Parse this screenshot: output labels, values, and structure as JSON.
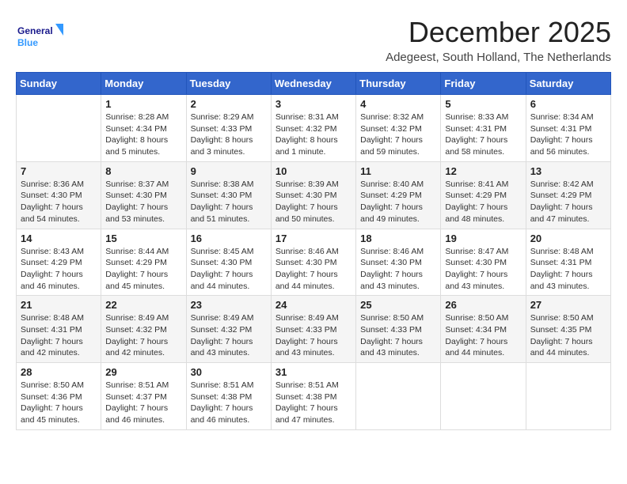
{
  "header": {
    "logo_general": "General",
    "logo_blue": "Blue",
    "month_title": "December 2025",
    "location": "Adegeest, South Holland, The Netherlands"
  },
  "weekdays": [
    "Sunday",
    "Monday",
    "Tuesday",
    "Wednesday",
    "Thursday",
    "Friday",
    "Saturday"
  ],
  "weeks": [
    [
      {
        "day": "",
        "info": ""
      },
      {
        "day": "1",
        "info": "Sunrise: 8:28 AM\nSunset: 4:34 PM\nDaylight: 8 hours\nand 5 minutes."
      },
      {
        "day": "2",
        "info": "Sunrise: 8:29 AM\nSunset: 4:33 PM\nDaylight: 8 hours\nand 3 minutes."
      },
      {
        "day": "3",
        "info": "Sunrise: 8:31 AM\nSunset: 4:32 PM\nDaylight: 8 hours\nand 1 minute."
      },
      {
        "day": "4",
        "info": "Sunrise: 8:32 AM\nSunset: 4:32 PM\nDaylight: 7 hours\nand 59 minutes."
      },
      {
        "day": "5",
        "info": "Sunrise: 8:33 AM\nSunset: 4:31 PM\nDaylight: 7 hours\nand 58 minutes."
      },
      {
        "day": "6",
        "info": "Sunrise: 8:34 AM\nSunset: 4:31 PM\nDaylight: 7 hours\nand 56 minutes."
      }
    ],
    [
      {
        "day": "7",
        "info": "Sunrise: 8:36 AM\nSunset: 4:30 PM\nDaylight: 7 hours\nand 54 minutes."
      },
      {
        "day": "8",
        "info": "Sunrise: 8:37 AM\nSunset: 4:30 PM\nDaylight: 7 hours\nand 53 minutes."
      },
      {
        "day": "9",
        "info": "Sunrise: 8:38 AM\nSunset: 4:30 PM\nDaylight: 7 hours\nand 51 minutes."
      },
      {
        "day": "10",
        "info": "Sunrise: 8:39 AM\nSunset: 4:30 PM\nDaylight: 7 hours\nand 50 minutes."
      },
      {
        "day": "11",
        "info": "Sunrise: 8:40 AM\nSunset: 4:29 PM\nDaylight: 7 hours\nand 49 minutes."
      },
      {
        "day": "12",
        "info": "Sunrise: 8:41 AM\nSunset: 4:29 PM\nDaylight: 7 hours\nand 48 minutes."
      },
      {
        "day": "13",
        "info": "Sunrise: 8:42 AM\nSunset: 4:29 PM\nDaylight: 7 hours\nand 47 minutes."
      }
    ],
    [
      {
        "day": "14",
        "info": "Sunrise: 8:43 AM\nSunset: 4:29 PM\nDaylight: 7 hours\nand 46 minutes."
      },
      {
        "day": "15",
        "info": "Sunrise: 8:44 AM\nSunset: 4:29 PM\nDaylight: 7 hours\nand 45 minutes."
      },
      {
        "day": "16",
        "info": "Sunrise: 8:45 AM\nSunset: 4:30 PM\nDaylight: 7 hours\nand 44 minutes."
      },
      {
        "day": "17",
        "info": "Sunrise: 8:46 AM\nSunset: 4:30 PM\nDaylight: 7 hours\nand 44 minutes."
      },
      {
        "day": "18",
        "info": "Sunrise: 8:46 AM\nSunset: 4:30 PM\nDaylight: 7 hours\nand 43 minutes."
      },
      {
        "day": "19",
        "info": "Sunrise: 8:47 AM\nSunset: 4:30 PM\nDaylight: 7 hours\nand 43 minutes."
      },
      {
        "day": "20",
        "info": "Sunrise: 8:48 AM\nSunset: 4:31 PM\nDaylight: 7 hours\nand 43 minutes."
      }
    ],
    [
      {
        "day": "21",
        "info": "Sunrise: 8:48 AM\nSunset: 4:31 PM\nDaylight: 7 hours\nand 42 minutes."
      },
      {
        "day": "22",
        "info": "Sunrise: 8:49 AM\nSunset: 4:32 PM\nDaylight: 7 hours\nand 42 minutes."
      },
      {
        "day": "23",
        "info": "Sunrise: 8:49 AM\nSunset: 4:32 PM\nDaylight: 7 hours\nand 43 minutes."
      },
      {
        "day": "24",
        "info": "Sunrise: 8:49 AM\nSunset: 4:33 PM\nDaylight: 7 hours\nand 43 minutes."
      },
      {
        "day": "25",
        "info": "Sunrise: 8:50 AM\nSunset: 4:33 PM\nDaylight: 7 hours\nand 43 minutes."
      },
      {
        "day": "26",
        "info": "Sunrise: 8:50 AM\nSunset: 4:34 PM\nDaylight: 7 hours\nand 44 minutes."
      },
      {
        "day": "27",
        "info": "Sunrise: 8:50 AM\nSunset: 4:35 PM\nDaylight: 7 hours\nand 44 minutes."
      }
    ],
    [
      {
        "day": "28",
        "info": "Sunrise: 8:50 AM\nSunset: 4:36 PM\nDaylight: 7 hours\nand 45 minutes."
      },
      {
        "day": "29",
        "info": "Sunrise: 8:51 AM\nSunset: 4:37 PM\nDaylight: 7 hours\nand 46 minutes."
      },
      {
        "day": "30",
        "info": "Sunrise: 8:51 AM\nSunset: 4:38 PM\nDaylight: 7 hours\nand 46 minutes."
      },
      {
        "day": "31",
        "info": "Sunrise: 8:51 AM\nSunset: 4:38 PM\nDaylight: 7 hours\nand 47 minutes."
      },
      {
        "day": "",
        "info": ""
      },
      {
        "day": "",
        "info": ""
      },
      {
        "day": "",
        "info": ""
      }
    ]
  ]
}
